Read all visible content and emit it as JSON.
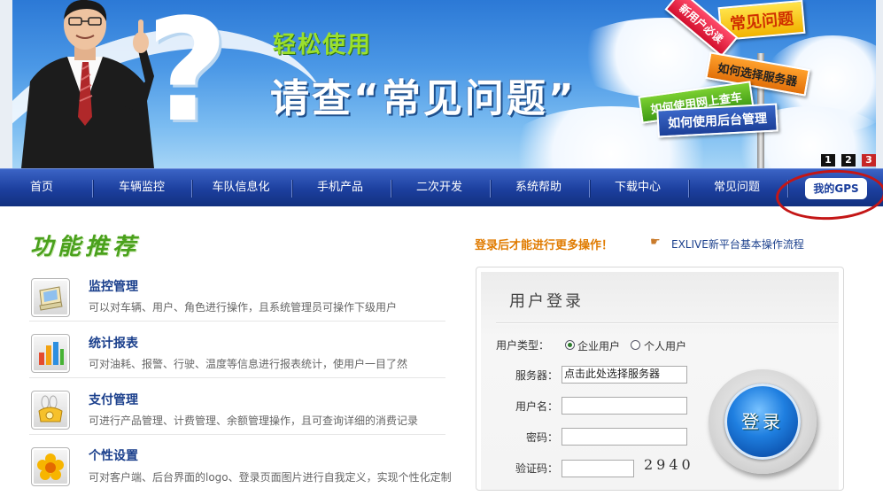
{
  "banner": {
    "slogan_small": "轻松使用",
    "slogan_big": "请查“常见问题”",
    "signs": [
      "常见问题",
      "新用户必读",
      "如何选择服务器",
      "如何使用网上查车",
      "如何使用后台管理"
    ],
    "pager": [
      "1",
      "2",
      "3"
    ],
    "pager_active": "3"
  },
  "nav": {
    "items": [
      "首页",
      "车辆监控",
      "车队信息化",
      "手机产品",
      "二次开发",
      "系统帮助",
      "下载中心",
      "常见问题"
    ],
    "my_gps": "我的GPS",
    "bg_color": "#1c3f9e"
  },
  "features": {
    "title": "功能推荐",
    "items": [
      {
        "icon": "monitor-icon",
        "name": "监控管理",
        "desc": "可以对车辆、用户、角色进行操作，且系统管理员可操作下级用户"
      },
      {
        "icon": "bar-chart-icon",
        "name": "统计报表",
        "desc": "可对油耗、报警、行驶、温度等信息进行报表统计，使用户一目了然"
      },
      {
        "icon": "wallet-icon",
        "name": "支付管理",
        "desc": "可进行产品管理、计费管理、余额管理操作，且可查询详细的消费记录"
      },
      {
        "icon": "flower-icon",
        "name": "个性设置",
        "desc": "可对客户端、后台界面的logo、登录页面图片进行自我定义，实现个性化定制"
      }
    ]
  },
  "login": {
    "note": "登录后才能进行更多操作！",
    "guide_link": "EXLIVE新平台基本操作流程",
    "title": "用户登录",
    "user_type_label": "用户类型：",
    "user_type_options": [
      "企业用户",
      "个人用户"
    ],
    "user_type_selected": "企业用户",
    "server_label": "服务器：",
    "server_value": "点击此处选择服务器",
    "username_label": "用户名：",
    "username_value": "",
    "password_label": "密码：",
    "password_value": "",
    "captcha_label": "验证码：",
    "captcha_value": "",
    "captcha_code": "2940",
    "submit_label": "登录"
  }
}
